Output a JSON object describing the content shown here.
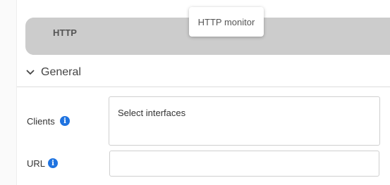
{
  "tab": {
    "label": "HTTP"
  },
  "tooltip": {
    "text": "HTTP monitor"
  },
  "section": {
    "title": "General",
    "icon": "chevron-down-icon"
  },
  "fields": {
    "clients": {
      "label": "Clients",
      "value": "Select interfaces",
      "icon": "info-icon"
    },
    "url": {
      "label": "URL",
      "value": "",
      "icon": "info-icon"
    }
  },
  "colors": {
    "tab_strip": "#cccccc",
    "info_icon": "#1f73e0",
    "border": "#cfcfcf"
  }
}
